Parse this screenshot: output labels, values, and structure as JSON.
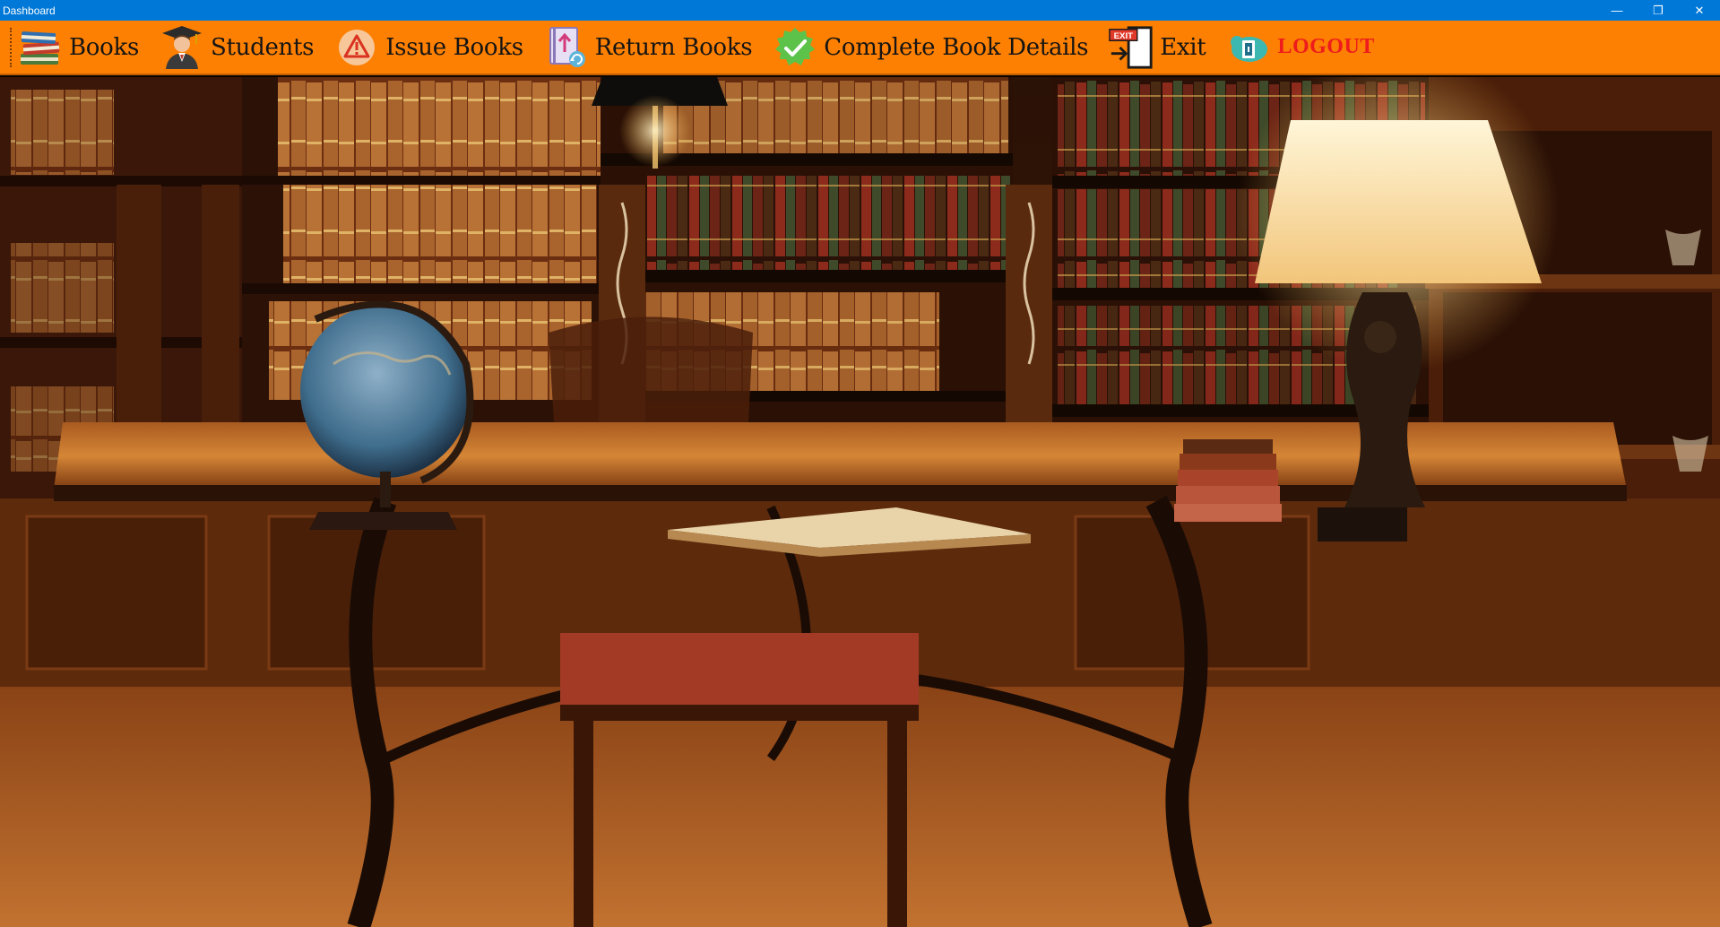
{
  "window": {
    "title": "Dashboard",
    "controls": {
      "minimize": "—",
      "maximize": "❐",
      "close": "✕"
    }
  },
  "toolbar": {
    "items": [
      {
        "label": "Books",
        "icon": "books-stack-icon"
      },
      {
        "label": "Students",
        "icon": "graduate-student-icon"
      },
      {
        "label": "Issue Books",
        "icon": "warning-triangle-icon"
      },
      {
        "label": "Return Books",
        "icon": "return-book-icon"
      },
      {
        "label": "Complete Book Details",
        "icon": "green-check-icon"
      },
      {
        "label": "Exit",
        "icon": "exit-door-icon"
      },
      {
        "label": "LOGOUT",
        "icon": "logout-icon"
      }
    ],
    "exit_sign_text": "EXIT"
  },
  "colors": {
    "titlebar": "#0078d7",
    "toolbar": "#fd8002",
    "logout_text": "#ee1c1c",
    "wood_dark": "#2a1206",
    "wood_mid": "#7a3a12",
    "wood_light": "#c86f2a"
  },
  "background_image": "library-study-room"
}
